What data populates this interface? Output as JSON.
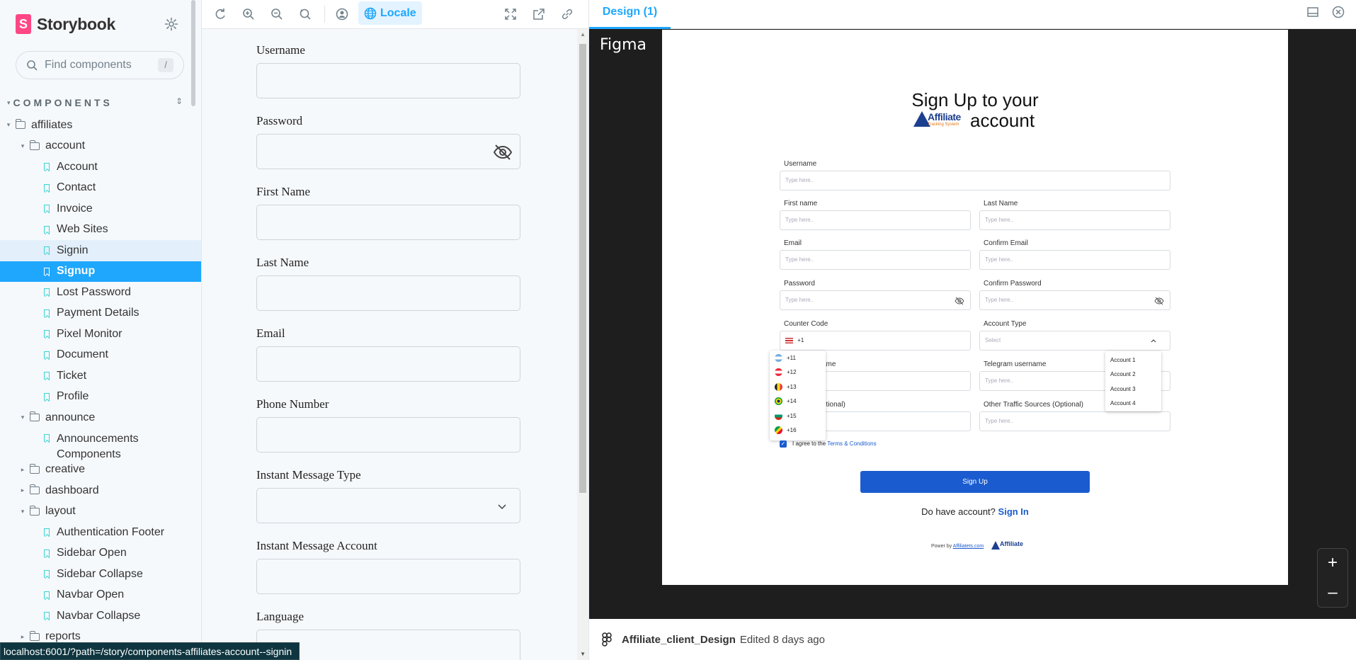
{
  "sidebar": {
    "brand": "Storybook",
    "search_placeholder": "Find components",
    "search_shortcut": "/",
    "section_title": "COMPONENTS",
    "tree": {
      "affiliates": "affiliates",
      "account": "account",
      "account_items": [
        "Account",
        "Contact",
        "Invoice",
        "Web Sites",
        "Signin",
        "Signup",
        "Lost Password",
        "Payment Details",
        "Pixel Monitor",
        "Document",
        "Ticket",
        "Profile"
      ],
      "announce": "announce",
      "announce_items": [
        "Announcements Components"
      ],
      "creative": "creative",
      "dashboard": "dashboard",
      "layout": "layout",
      "layout_items": [
        "Authentication Footer",
        "Sidebar Open",
        "Sidebar Collapse",
        "Navbar Open",
        "Navbar Collapse"
      ],
      "reports": "reports"
    },
    "selected_item": "Signup",
    "hovered_item": "Signin"
  },
  "toolbar": {
    "locale_label": "Locale",
    "icons": [
      "reload-icon",
      "zoom-in-icon",
      "zoom-out-icon",
      "zoom-reset-icon",
      "user-icon",
      "globe-icon",
      "fullscreen-icon",
      "open-new-tab-icon",
      "copy-link-icon"
    ]
  },
  "story_form": {
    "fields": [
      {
        "label": "Username",
        "type": "text"
      },
      {
        "label": "Password",
        "type": "password"
      },
      {
        "label": "First Name",
        "type": "text"
      },
      {
        "label": "Last Name",
        "type": "text"
      },
      {
        "label": "Email",
        "type": "text"
      },
      {
        "label": "Phone Number",
        "type": "text"
      },
      {
        "label": "Instant Message Type",
        "type": "select"
      },
      {
        "label": "Instant Message Account",
        "type": "text"
      },
      {
        "label": "Language",
        "type": "text"
      }
    ]
  },
  "status_url": "localhost:6001/?path=/story/components-affiliates-account--signin",
  "panel": {
    "tab_label": "Design (1)",
    "figma_label": "Figma",
    "footer_file": "Affiliate_client_Design",
    "footer_edited": "Edited 8 days ago",
    "zoom_in": "+",
    "zoom_out": "–"
  },
  "design": {
    "title_line1": "Sign Up to your",
    "title_line2": "account",
    "logo_text": "Affiliate",
    "logo_sub": "Tracking System",
    "placeholder": "Type here..",
    "select_placeholder": "Select",
    "labels": {
      "username": "Username",
      "first_name": "First name",
      "last_name": "Last Name",
      "email": "Email",
      "confirm_email": "Confirm Email",
      "password": "Password",
      "confirm_password": "Confirm Password",
      "country_code": "Counter Code",
      "account_type": "Account Type",
      "messenger_name": "ame",
      "telegram": "Telegram username",
      "traffic_partial": "otional)",
      "other_traffic": "Other Traffic Sources (Optional)"
    },
    "country_code_value": "+1",
    "country_codes": [
      "+11",
      "+12",
      "+13",
      "+14",
      "+15",
      "+16"
    ],
    "account_types": [
      "Account 1",
      "Account 2",
      "Account 3",
      "Account 4"
    ],
    "agree_text": "I agree to the",
    "agree_link": "Terms & Conditions",
    "button": "Sign Up",
    "have_account": "Do have account?",
    "sign_in": "Sign In",
    "powered": "Power by",
    "powered_link": "Affiliatets.com",
    "powered_logo": "Affiliate"
  }
}
